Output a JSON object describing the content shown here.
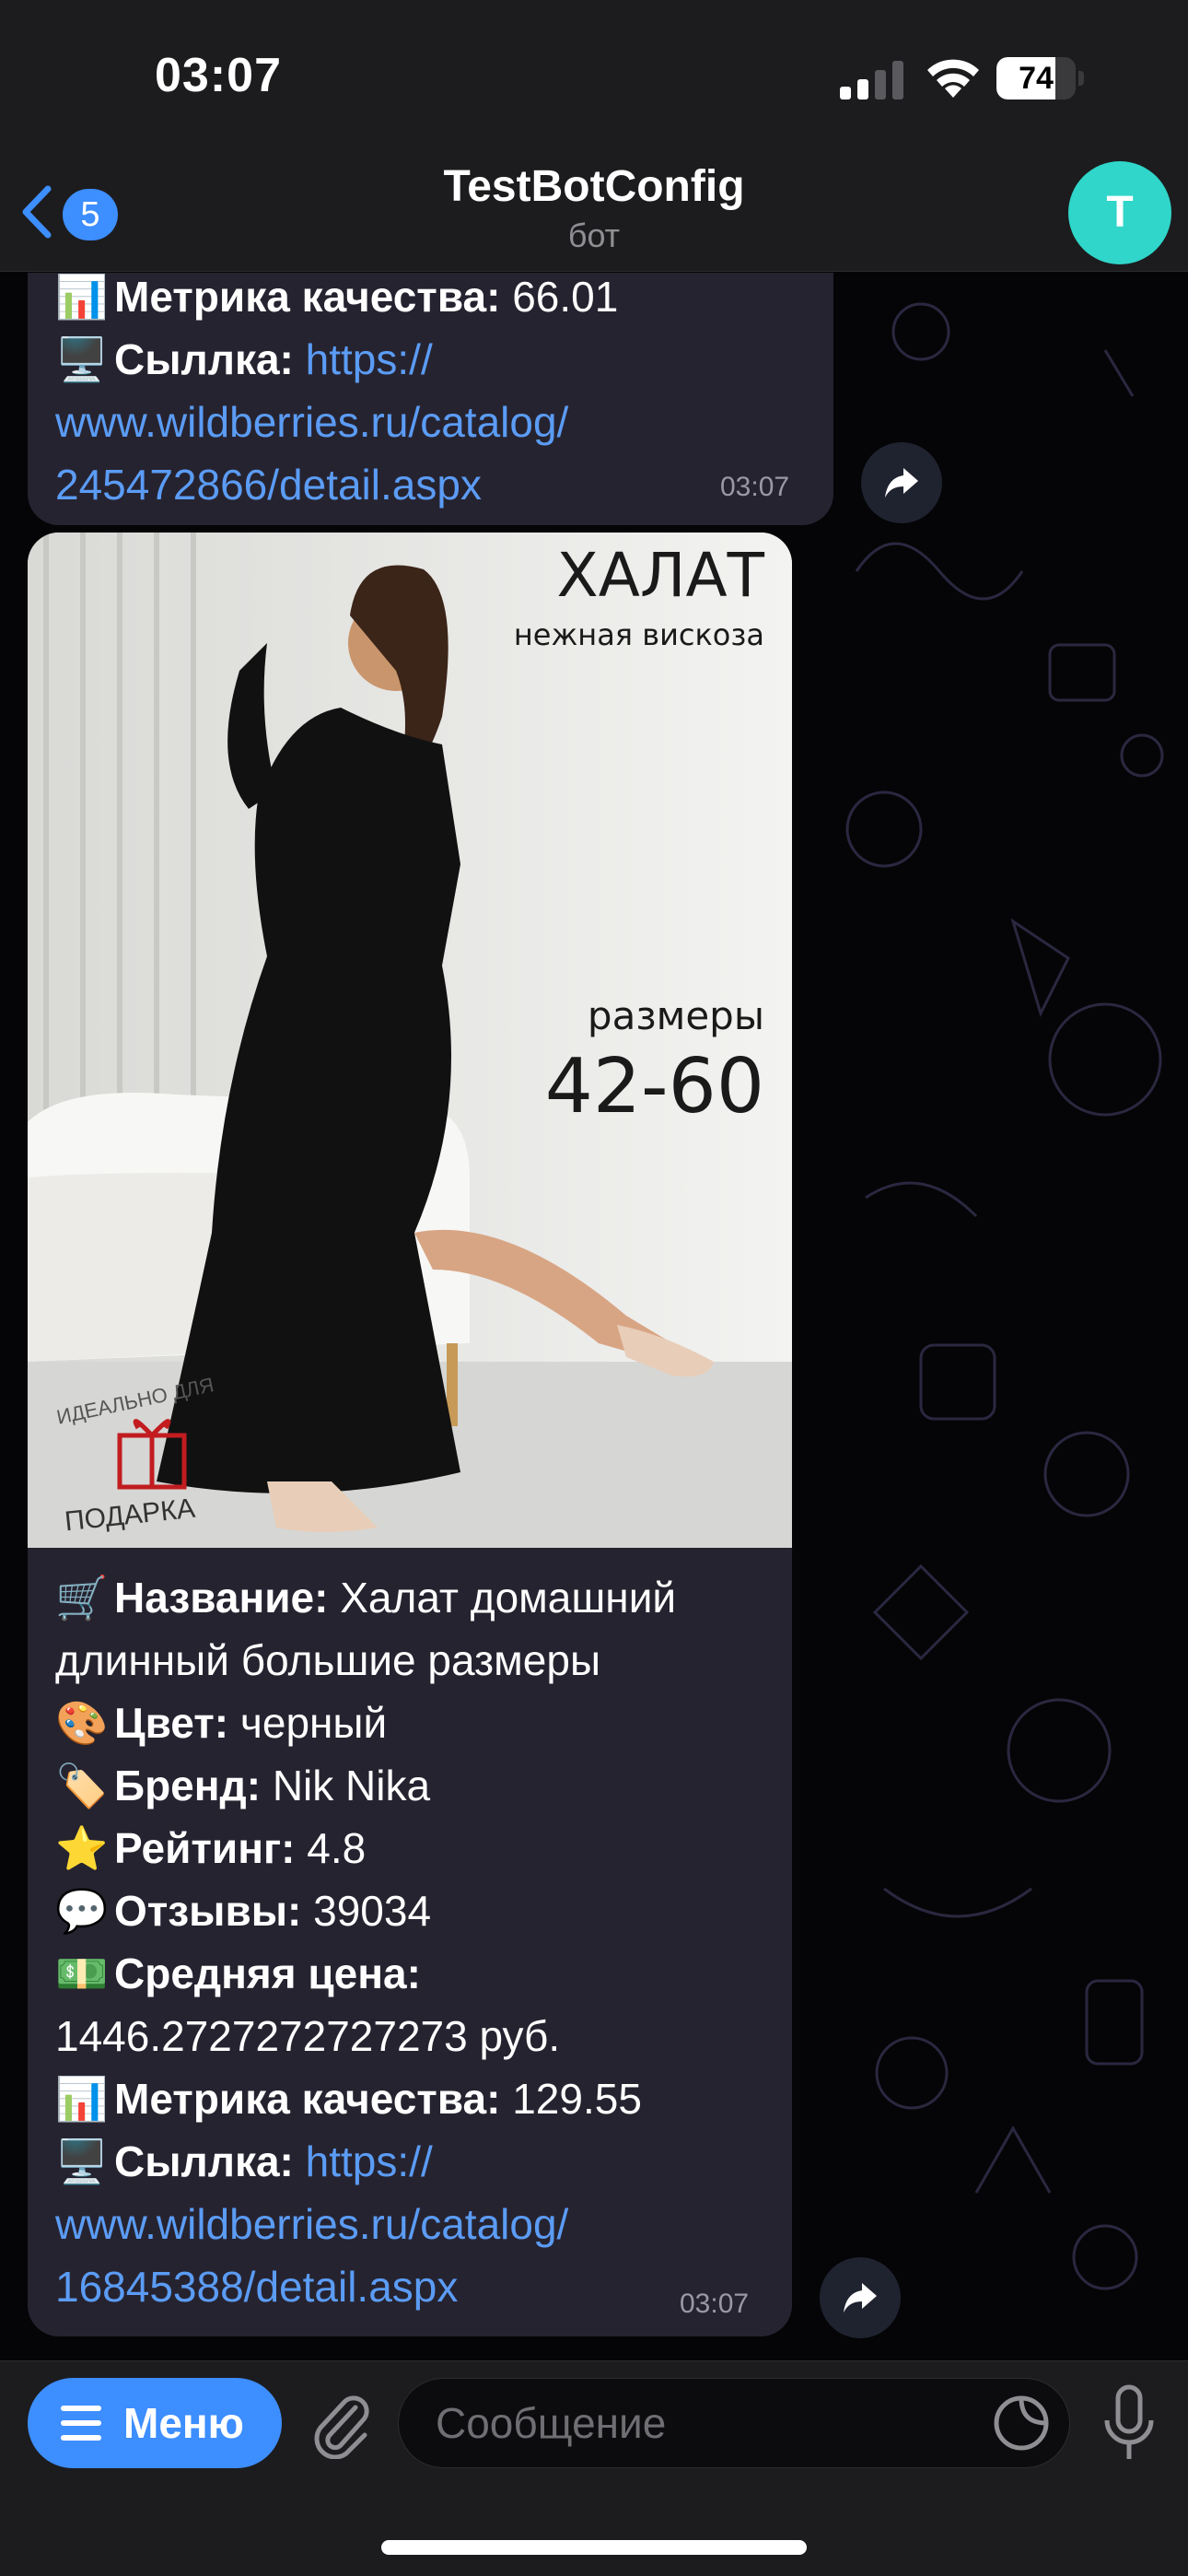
{
  "status": {
    "time": "03:07",
    "battery": "74",
    "battery_level": 0.74
  },
  "header": {
    "back_count": "5",
    "title": "TestBotConfig",
    "subtitle": "бот",
    "avatar_letter": "T"
  },
  "message1": {
    "metric_emoji": "📊",
    "metric_label": "Метрика качества:",
    "metric_value": " 66.01",
    "link_emoji": "🖥️",
    "link_label": "Сыллка:",
    "link_l1": "https://",
    "link_l2": "www.wildberries.ru/catalog/",
    "link_l3": "245472866/detail.aspx",
    "time": "03:07"
  },
  "product_image": {
    "title": "ХАЛАТ",
    "subtitle": "нежная вискоза",
    "sizes_label": "размеры",
    "sizes_value": "42-60",
    "gift_top": "ИДЕАЛЬНО ДЛЯ",
    "gift_bottom": "ПОДАРКА"
  },
  "message2": {
    "name_emoji": "🛒",
    "name_label": "Название:",
    "name_l1": " Халат домашний",
    "name_l2": "длинный большие размеры",
    "color_emoji": "🎨",
    "color_label": "Цвет:",
    "color_value": " черный",
    "brand_emoji": "🏷️",
    "brand_label": "Бренд:",
    "brand_value": " Nik Nika",
    "rating_emoji": "⭐",
    "rating_label": "Рейтинг:",
    "rating_value": " 4.8",
    "reviews_emoji": "💬",
    "reviews_label": "Отзывы:",
    "reviews_value": " 39034",
    "price_emoji": "💵",
    "price_label": "Средняя цена:",
    "price_value": "1446.2727272727273 руб.",
    "metric_emoji": "📊",
    "metric_label": "Метрика качества:",
    "metric_value": " 129.55",
    "link_emoji": "🖥️",
    "link_label": "Сыллка:",
    "link_l1": "https://",
    "link_l2": "www.wildberries.ru/catalog/",
    "link_l3": "16845388/detail.aspx",
    "time": "03:07"
  },
  "composer": {
    "menu_label": "Меню",
    "placeholder": "Сообщение"
  },
  "colors": {
    "accent": "#3d8eff",
    "bubble": "#262330",
    "link": "#5b9cf5",
    "avatar": "#2fd6c9"
  }
}
